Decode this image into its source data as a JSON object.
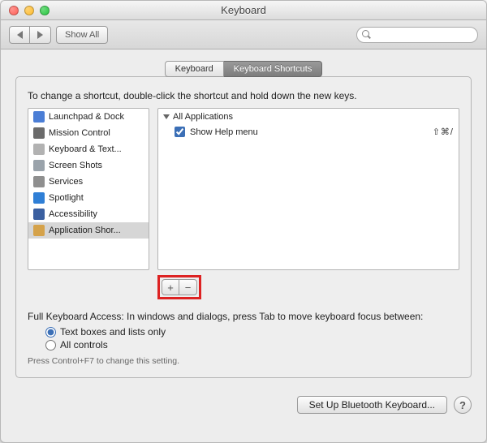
{
  "window": {
    "title": "Keyboard"
  },
  "toolbar": {
    "showAll": "Show All",
    "searchPlaceholder": ""
  },
  "tabs": [
    {
      "label": "Keyboard",
      "active": false
    },
    {
      "label": "Keyboard Shortcuts",
      "active": true
    }
  ],
  "instruction": "To change a shortcut, double-click the shortcut and hold down the new keys.",
  "sidebar": {
    "items": [
      {
        "label": "Launchpad & Dock",
        "iconColor": "#4b7ed6"
      },
      {
        "label": "Mission Control",
        "iconColor": "#6b6b6b"
      },
      {
        "label": "Keyboard & Text...",
        "iconColor": "#b2b2b2"
      },
      {
        "label": "Screen Shots",
        "iconColor": "#9aa3ab"
      },
      {
        "label": "Services",
        "iconColor": "#8f8f8f"
      },
      {
        "label": "Spotlight",
        "iconColor": "#2f7fd6"
      },
      {
        "label": "Accessibility",
        "iconColor": "#3a5fa0"
      },
      {
        "label": "Application Shor...",
        "iconColor": "#d5a24a",
        "selected": true
      }
    ]
  },
  "detail": {
    "header": "All Applications",
    "rows": [
      {
        "checked": true,
        "label": "Show Help menu",
        "shortcut": "⇧⌘/"
      }
    ]
  },
  "buttons": {
    "add": "+",
    "remove": "−"
  },
  "fka": {
    "label": "Full Keyboard Access: In windows and dialogs, press Tab to move keyboard focus between:",
    "options": [
      {
        "label": "Text boxes and lists only",
        "checked": true
      },
      {
        "label": "All controls",
        "checked": false
      }
    ],
    "hint": "Press Control+F7 to change this setting."
  },
  "footer": {
    "bluetooth": "Set Up Bluetooth Keyboard...",
    "help": "?"
  }
}
